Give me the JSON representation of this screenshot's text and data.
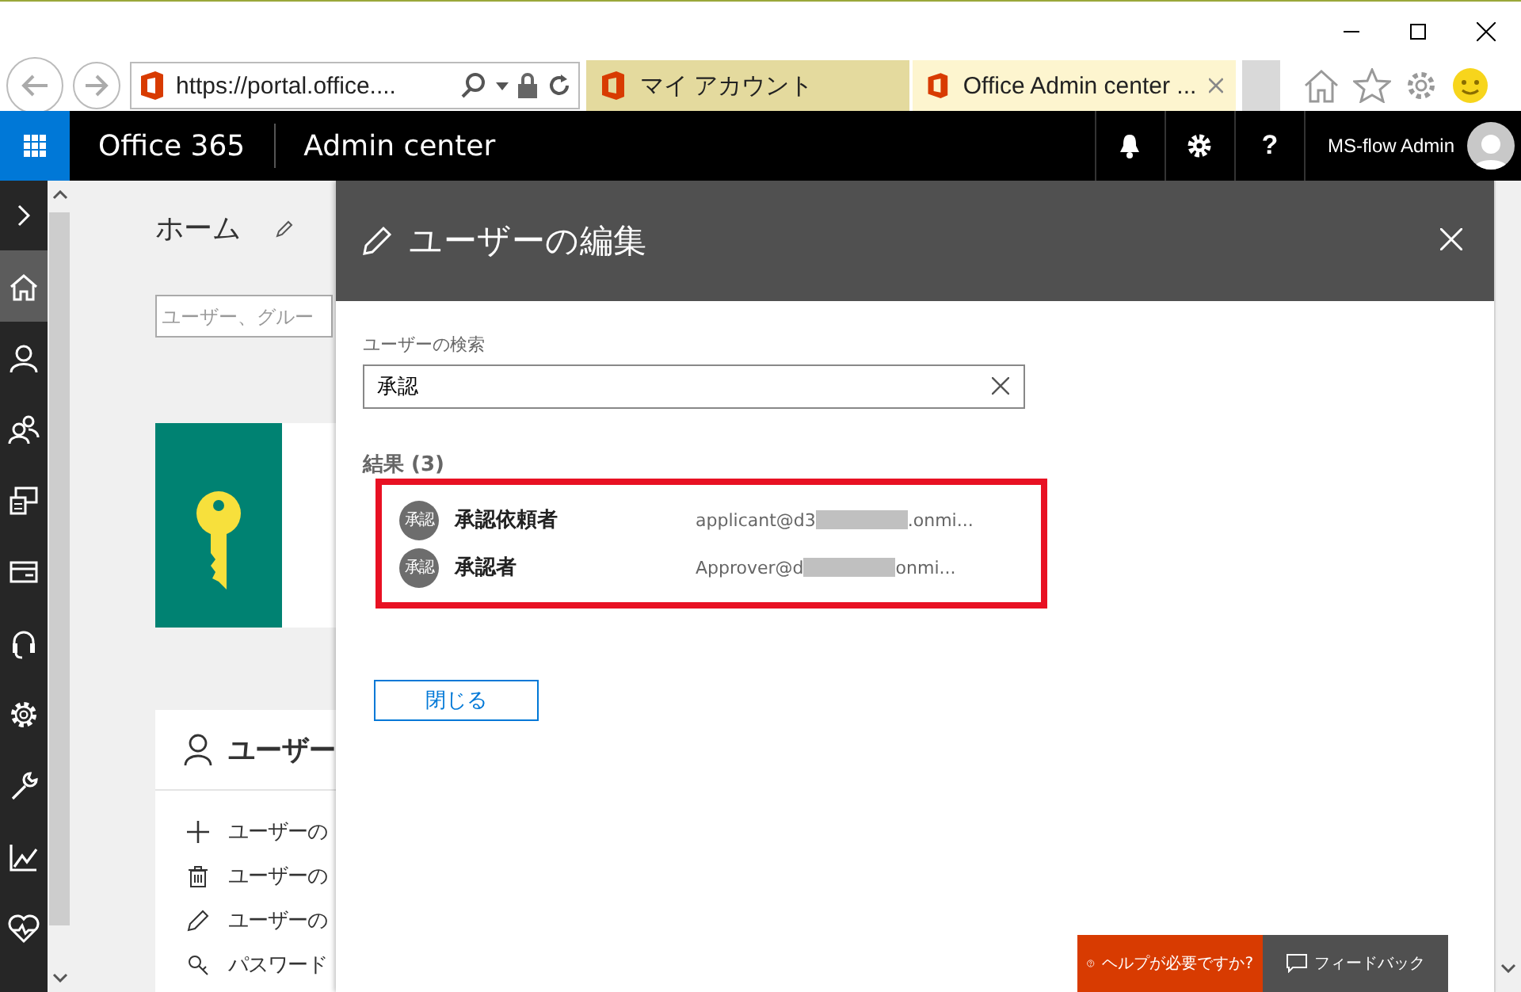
{
  "browser": {
    "url": "https://portal.office....",
    "tabs": [
      {
        "label": "マイ アカウント",
        "selected": false
      },
      {
        "label": "Office Admin center ...",
        "selected": true
      }
    ]
  },
  "header": {
    "app": "Office 365",
    "section": "Admin center",
    "help_glyph": "?",
    "user": "MS-flow Admin"
  },
  "nav": {
    "items": [
      {
        "kind": "home",
        "selected": true
      },
      {
        "kind": "user",
        "selected": false
      },
      {
        "kind": "group",
        "selected": false
      },
      {
        "kind": "device",
        "selected": false
      },
      {
        "kind": "billing",
        "selected": false
      },
      {
        "kind": "support",
        "selected": false
      },
      {
        "kind": "settings",
        "selected": false
      },
      {
        "kind": "setup",
        "selected": false
      },
      {
        "kind": "reports",
        "selected": false
      },
      {
        "kind": "health",
        "selected": false
      }
    ]
  },
  "home": {
    "title": "ホーム",
    "search_placeholder": "ユーザー、グルー",
    "users_card": {
      "title": "ユーザー",
      "actions": [
        {
          "kind": "add",
          "label": "ユーザーの"
        },
        {
          "kind": "delete",
          "label": "ユーザーの"
        },
        {
          "kind": "edit",
          "label": "ユーザーの"
        },
        {
          "kind": "password",
          "label": "パスワード"
        }
      ]
    }
  },
  "panel": {
    "title": "ユーザーの編集",
    "search_label": "ユーザーの検索",
    "search_value": "承認",
    "results_heading": "結果 (3)",
    "results": [
      {
        "avatar": "承認",
        "name": "承認依頼者",
        "email_start": "applicant@d3",
        "email_end": ".onmi..."
      },
      {
        "avatar": "承認",
        "name": "承認者",
        "email_start": "Approver@d",
        "email_end": "onmi..."
      }
    ],
    "close_button": "閉じる"
  },
  "help_bar": {
    "help": "ヘルプが必要ですか?",
    "feedback": "フィードバック"
  }
}
